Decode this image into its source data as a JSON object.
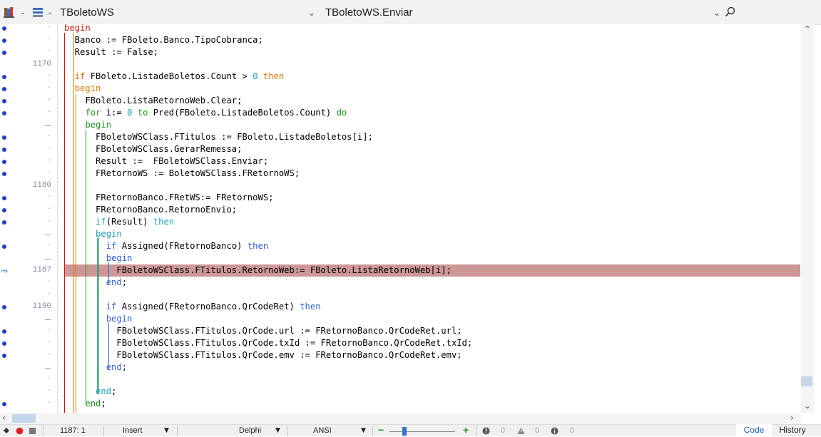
{
  "toolbar": {
    "unit_name": "TBoletoWS",
    "method_name": "TBoletoWS.Enviar",
    "icons": [
      "books-icon",
      "chevron-down-icon",
      "structure-icon",
      "chevron-down-icon",
      "chevron-down-icon",
      "navigate-icon"
    ]
  },
  "line_numbers": {
    "n1170": "1170",
    "n1180": "1180",
    "n1187": "1187",
    "n1190": "1190"
  },
  "code": [
    {
      "parts": [
        {
          "t": "begin",
          "c": "kw-red"
        }
      ]
    },
    {
      "parts": [
        {
          "t": "  Banco := FBoleto.Banco.TipoCobranca;",
          "c": ""
        }
      ]
    },
    {
      "parts": [
        {
          "t": "  Result := False;",
          "c": ""
        }
      ]
    },
    {
      "parts": []
    },
    {
      "parts": [
        {
          "t": "  ",
          "c": ""
        },
        {
          "t": "if",
          "c": "kw-orange"
        },
        {
          "t": " FBoleto.ListadeBoletos.Count > ",
          "c": ""
        },
        {
          "t": "0",
          "c": "kw-teal"
        },
        {
          "t": " ",
          "c": ""
        },
        {
          "t": "then",
          "c": "kw-orange"
        }
      ]
    },
    {
      "parts": [
        {
          "t": "  ",
          "c": ""
        },
        {
          "t": "begin",
          "c": "kw-orange"
        }
      ]
    },
    {
      "parts": [
        {
          "t": "    FBoleto.ListaRetornoWeb.Clear;",
          "c": ""
        }
      ]
    },
    {
      "parts": [
        {
          "t": "    ",
          "c": ""
        },
        {
          "t": "for",
          "c": "kw-green"
        },
        {
          "t": " i:= ",
          "c": ""
        },
        {
          "t": "0",
          "c": "kw-teal"
        },
        {
          "t": " ",
          "c": ""
        },
        {
          "t": "to",
          "c": "kw-green"
        },
        {
          "t": " Pred(FBoleto.ListadeBoletos.Count) ",
          "c": ""
        },
        {
          "t": "do",
          "c": "kw-green"
        }
      ]
    },
    {
      "parts": [
        {
          "t": "    ",
          "c": ""
        },
        {
          "t": "begin",
          "c": "kw-green"
        }
      ]
    },
    {
      "parts": [
        {
          "t": "      FBoletoWSClass.FTitulos := FBoleto.ListadeBoletos[i];",
          "c": ""
        }
      ]
    },
    {
      "parts": [
        {
          "t": "      FBoletoWSClass.GerarRemessa;",
          "c": ""
        }
      ]
    },
    {
      "parts": [
        {
          "t": "      Result :=  FBoletoWSClass.Enviar;",
          "c": ""
        }
      ]
    },
    {
      "parts": [
        {
          "t": "      FRetornoWS := BoletoWSClass.FRetornoWS;",
          "c": ""
        }
      ]
    },
    {
      "parts": []
    },
    {
      "parts": [
        {
          "t": "      FRetornoBanco.FRetWS:= FRetornoWS;",
          "c": ""
        }
      ]
    },
    {
      "parts": [
        {
          "t": "      FRetornoBanco.RetornoEnvio;",
          "c": ""
        }
      ]
    },
    {
      "parts": [
        {
          "t": "      ",
          "c": ""
        },
        {
          "t": "if",
          "c": "kw-teal"
        },
        {
          "t": "(Result) ",
          "c": ""
        },
        {
          "t": "then",
          "c": "kw-teal"
        }
      ]
    },
    {
      "parts": [
        {
          "t": "      ",
          "c": ""
        },
        {
          "t": "begin",
          "c": "kw-teal"
        }
      ]
    },
    {
      "parts": [
        {
          "t": "        ",
          "c": ""
        },
        {
          "t": "if",
          "c": "kw-blue"
        },
        {
          "t": " Assigned(FRetornoBanco) ",
          "c": ""
        },
        {
          "t": "then",
          "c": "kw-blue"
        }
      ]
    },
    {
      "parts": [
        {
          "t": "        ",
          "c": ""
        },
        {
          "t": "begin",
          "c": "kw-blue"
        }
      ]
    },
    {
      "parts": [
        {
          "t": "          FBoletoWSClass.FTitulos.RetornoWeb:= FBoleto.ListaRetornoWeb[i];",
          "c": ""
        }
      ]
    },
    {
      "parts": [
        {
          "t": "        ",
          "c": ""
        },
        {
          "t": "end",
          "c": "kw-blue"
        },
        {
          "t": ";",
          "c": ""
        }
      ]
    },
    {
      "parts": []
    },
    {
      "parts": [
        {
          "t": "        ",
          "c": ""
        },
        {
          "t": "if",
          "c": "kw-blue"
        },
        {
          "t": " Assigned(FRetornoBanco.QrCodeRet) ",
          "c": ""
        },
        {
          "t": "then",
          "c": "kw-blue"
        }
      ]
    },
    {
      "parts": [
        {
          "t": "        ",
          "c": ""
        },
        {
          "t": "begin",
          "c": "kw-blue"
        }
      ]
    },
    {
      "parts": [
        {
          "t": "          FBoletoWSClass.FTitulos.QrCode.url := FRetornoBanco.QrCodeRet.url;",
          "c": ""
        }
      ]
    },
    {
      "parts": [
        {
          "t": "          FBoletoWSClass.FTitulos.QrCode.txId := FRetornoBanco.QrCodeRet.txId;",
          "c": ""
        }
      ]
    },
    {
      "parts": [
        {
          "t": "          FBoletoWSClass.FTitulos.QrCode.emv := FRetornoBanco.QrCodeRet.emv;",
          "c": ""
        }
      ]
    },
    {
      "parts": [
        {
          "t": "        ",
          "c": ""
        },
        {
          "t": "end",
          "c": "kw-blue"
        },
        {
          "t": ";",
          "c": ""
        }
      ]
    },
    {
      "parts": []
    },
    {
      "parts": [
        {
          "t": "      ",
          "c": ""
        },
        {
          "t": "end",
          "c": "kw-teal"
        },
        {
          "t": ";",
          "c": ""
        }
      ]
    },
    {
      "parts": [
        {
          "t": "    ",
          "c": ""
        },
        {
          "t": "end",
          "c": "kw-green"
        },
        {
          "t": ";",
          "c": ""
        }
      ]
    }
  ],
  "statusbar": {
    "position": "1187: 1",
    "mode": "Insert",
    "language": "Delphi",
    "encoding": "ANSI",
    "errors": "0",
    "warnings": "0",
    "hints": "0",
    "tab_code": "Code",
    "tab_history": "History"
  },
  "colors": {
    "highlight": "#cc9796",
    "breakpoint_dot": "#1a3fd0",
    "guide_red": "#d01010",
    "guide_orange": "#e07800",
    "guide_green": "#1a9a1a",
    "guide_teal": "#1aa0b8",
    "guide_blue": "#2b62d8"
  }
}
